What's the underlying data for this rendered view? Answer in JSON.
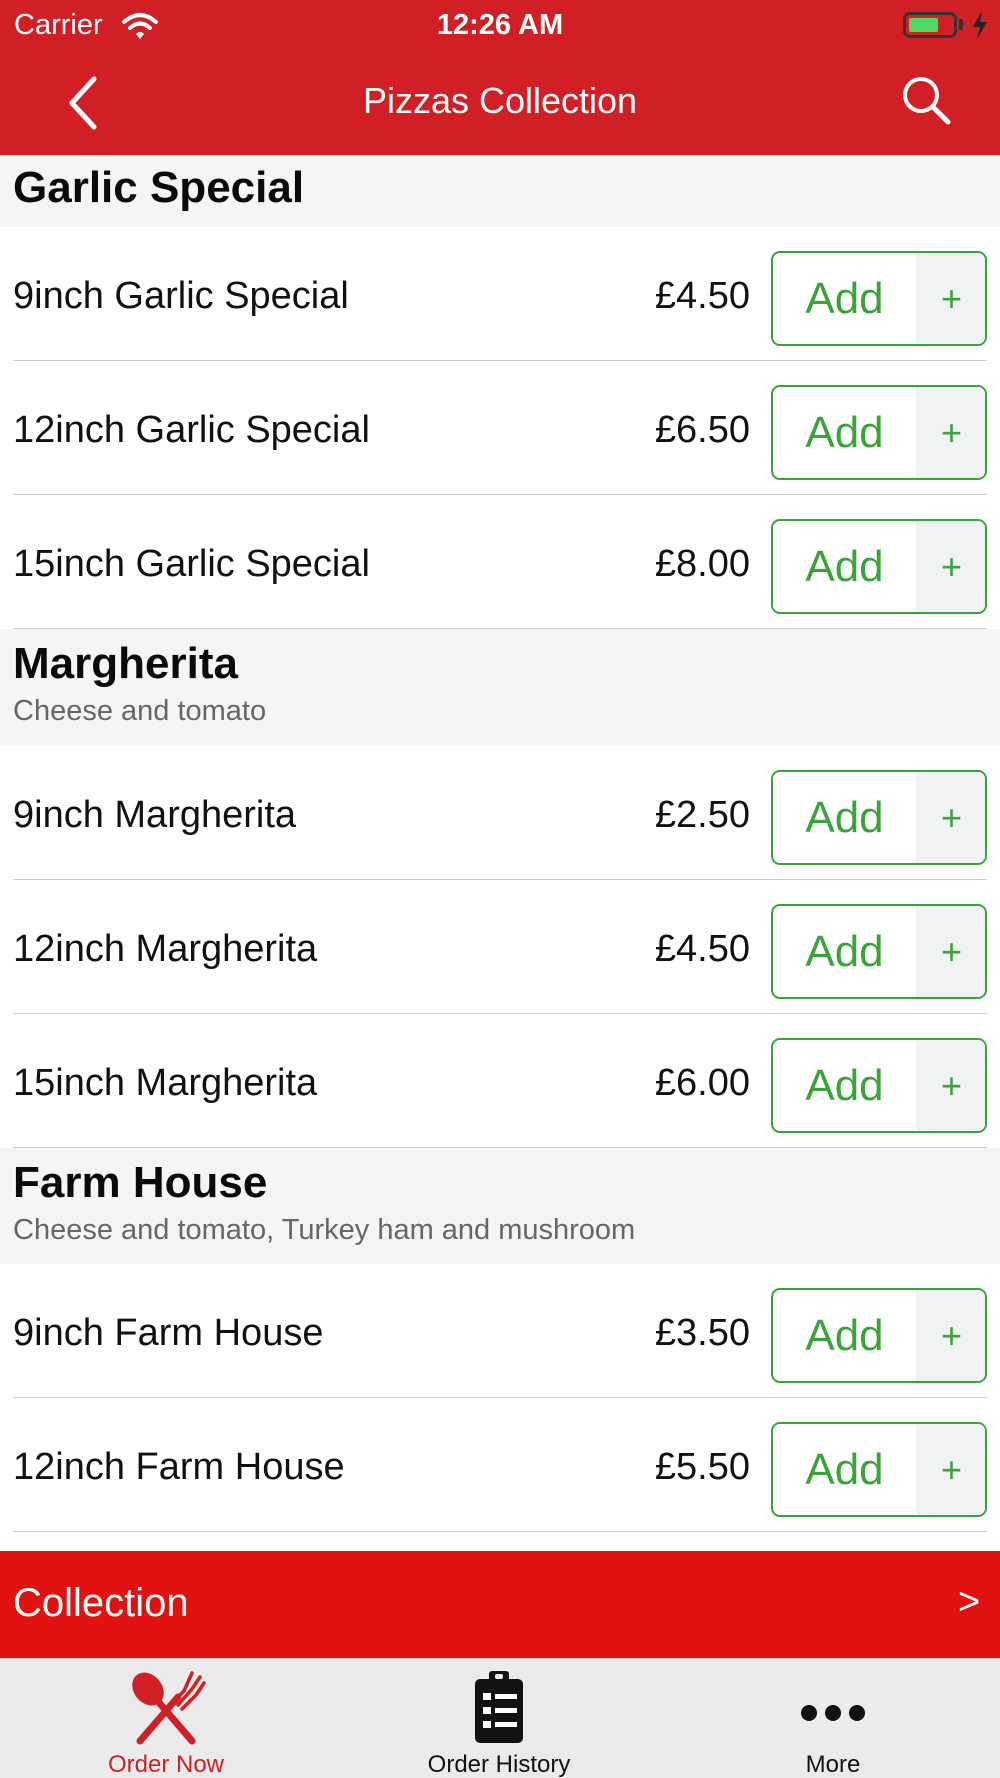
{
  "status_bar": {
    "carrier": "Carrier",
    "time": "12:26 AM",
    "battery_level": 0.7
  },
  "nav": {
    "title": "Pizzas Collection",
    "back_icon": "chevron-left-icon",
    "search_icon": "search-icon"
  },
  "sections": [
    {
      "title": "Garlic Special",
      "description": "",
      "items": [
        {
          "name": "9inch Garlic Special",
          "price": "£4.50",
          "add_label": "Add",
          "plus_label": "+"
        },
        {
          "name": "12inch Garlic Special",
          "price": "£6.50",
          "add_label": "Add",
          "plus_label": "+"
        },
        {
          "name": "15inch Garlic Special",
          "price": "£8.00",
          "add_label": "Add",
          "plus_label": "+"
        }
      ]
    },
    {
      "title": "Margherita",
      "description": "Cheese and tomato",
      "items": [
        {
          "name": "9inch Margherita",
          "price": "£2.50",
          "add_label": "Add",
          "plus_label": "+"
        },
        {
          "name": "12inch Margherita",
          "price": "£4.50",
          "add_label": "Add",
          "plus_label": "+"
        },
        {
          "name": "15inch Margherita",
          "price": "£6.00",
          "add_label": "Add",
          "plus_label": "+"
        }
      ]
    },
    {
      "title": "Farm House",
      "description": "Cheese and tomato, Turkey ham and mushroom",
      "items": [
        {
          "name": "9inch Farm House",
          "price": "£3.50",
          "add_label": "Add",
          "plus_label": "+"
        },
        {
          "name": "12inch Farm House",
          "price": "£5.50",
          "add_label": "Add",
          "plus_label": "+"
        }
      ]
    }
  ],
  "collection_bar": {
    "label": "Collection",
    "arrow": ">"
  },
  "tabs": [
    {
      "label": "Order Now",
      "icon": "fork-knife-icon",
      "active": true
    },
    {
      "label": "Order History",
      "icon": "clipboard-icon",
      "active": false
    },
    {
      "label": "More",
      "icon": "more-dots-icon",
      "active": false
    }
  ],
  "colors": {
    "brand_red": "#d01f25",
    "collection_red": "#e01212",
    "add_green": "#3aa43a",
    "section_bg": "#f4f5f7",
    "battery_green": "#4cd964"
  }
}
